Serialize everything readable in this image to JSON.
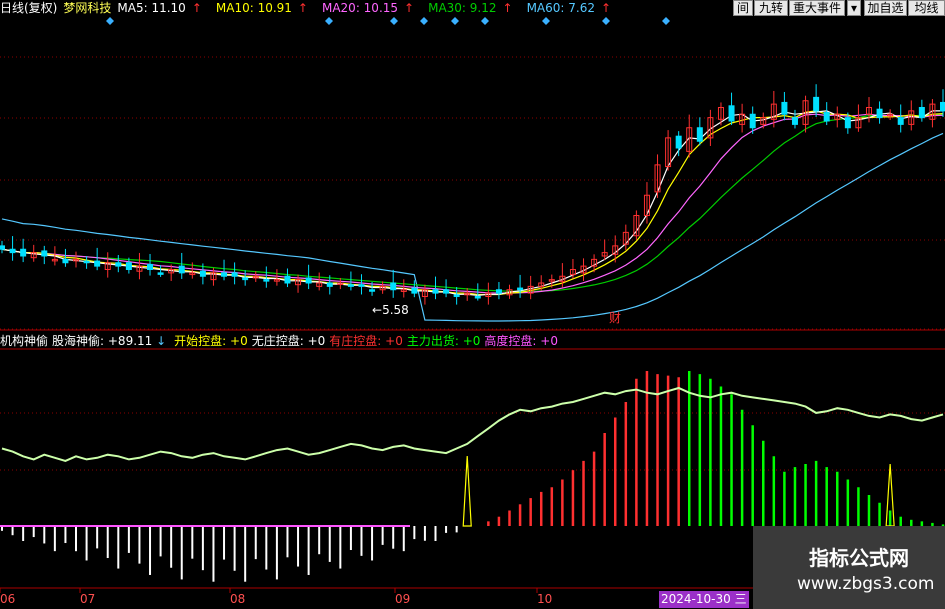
{
  "header": {
    "period": "日线(复权)",
    "stock": "梦网科技",
    "ma": [
      {
        "label": "MA5:",
        "value": "11.10",
        "color": "#ffffff",
        "arrow": "↑"
      },
      {
        "label": "MA10:",
        "value": "10.91",
        "color": "#ffff00",
        "arrow": "↑"
      },
      {
        "label": "MA20:",
        "value": "10.15",
        "color": "#ff66ff",
        "arrow": "↑"
      },
      {
        "label": "MA30:",
        "value": "9.12",
        "color": "#00cc00",
        "arrow": "↑"
      },
      {
        "label": "MA60:",
        "value": "7.62",
        "color": "#55c8ff",
        "arrow": "↑"
      }
    ],
    "buttons": [
      "间",
      "九转",
      "重大事件",
      "▾",
      "加自选",
      "均线"
    ]
  },
  "price_annotations": {
    "low": "5.58",
    "low_arrow": "←",
    "event": "财"
  },
  "indicator_header": {
    "name": "机构神偷",
    "items": [
      {
        "label": "股海神偷:",
        "value": "+89.11",
        "suffix": "↓",
        "color": "#ffffff"
      },
      {
        "label": "开始控盘:",
        "value": "+0",
        "color": "#ffff00"
      },
      {
        "label": "无庄控盘:",
        "value": "+0",
        "color": "#ffffff"
      },
      {
        "label": "有庄控盘:",
        "value": "+0",
        "color": "#ff3030"
      },
      {
        "label": "主力出货:",
        "value": "+0",
        "color": "#00ff00"
      },
      {
        "label": "高度控盘:",
        "value": "+0",
        "color": "#ff55ff"
      }
    ]
  },
  "x_axis": {
    "labels": [
      "06",
      "07",
      "08",
      "09",
      "10"
    ],
    "cursor_date": "2024-10-30",
    "cursor_day": "三"
  },
  "watermark": {
    "title": "指标公式网",
    "url": "www.zbgs3.com"
  },
  "colors": {
    "up": "#ff3030",
    "down": "#00e0ff",
    "ma5": "#ffffff",
    "ma10": "#ffff00",
    "ma20": "#ff66ff",
    "ma30": "#00cc00",
    "ma60": "#55c8ff",
    "line": "#ccffaa",
    "grid": "#8b0000"
  },
  "chart_data": [
    {
      "type": "candlestick",
      "title": "",
      "x_labels": [
        "06",
        "07",
        "08",
        "09",
        "10"
      ],
      "price_low": 5.58,
      "close": [
        7.0,
        6.9,
        6.8,
        6.9,
        6.8,
        6.7,
        6.6,
        6.7,
        6.6,
        6.5,
        6.6,
        6.5,
        6.4,
        6.5,
        6.4,
        6.3,
        6.4,
        6.3,
        6.3,
        6.2,
        6.3,
        6.2,
        6.2,
        6.1,
        6.2,
        6.1,
        6.1,
        6.0,
        6.1,
        6.0,
        6.0,
        5.9,
        6.0,
        5.9,
        5.9,
        5.8,
        5.9,
        5.8,
        5.8,
        5.7,
        5.8,
        5.7,
        5.7,
        5.6,
        5.7,
        5.6,
        5.7,
        5.7,
        5.8,
        5.8,
        5.9,
        6.0,
        6.1,
        6.2,
        6.4,
        6.5,
        6.7,
        6.9,
        7.1,
        7.5,
        8.0,
        8.6,
        9.5,
        10.3,
        10.0,
        10.6,
        10.2,
        10.9,
        11.2,
        10.8,
        11.0,
        10.6,
        10.9,
        11.3,
        11.0,
        10.7,
        11.4,
        11.1,
        10.8,
        11.0,
        10.6,
        10.9,
        11.2,
        10.9,
        11.0,
        10.7,
        11.1,
        10.9,
        11.3,
        11.1
      ],
      "ma": {
        "MA5": 11.1,
        "MA10": 10.91,
        "MA20": 10.15,
        "MA30": 9.12,
        "MA60": 7.62
      }
    },
    {
      "type": "bar",
      "title": "机构神偷",
      "series": [
        {
          "name": "股海神偷",
          "values": [
            50,
            48,
            45,
            43,
            46,
            44,
            42,
            45,
            43,
            44,
            46,
            45,
            43,
            44,
            46,
            48,
            47,
            45,
            44,
            46,
            47,
            45,
            44,
            43,
            45,
            47,
            49,
            50,
            48,
            46,
            47,
            49,
            51,
            53,
            52,
            50,
            49,
            51,
            52,
            50,
            49,
            48,
            47,
            50,
            53,
            58,
            63,
            68,
            72,
            75,
            74,
            76,
            77,
            79,
            80,
            82,
            84,
            86,
            85,
            87,
            88,
            86,
            85,
            87,
            89,
            86,
            84,
            83,
            85,
            86,
            84,
            83,
            82,
            81,
            80,
            79,
            77,
            73,
            74,
            76,
            75,
            73,
            71,
            70,
            72,
            71,
            69,
            68,
            70,
            72
          ]
        },
        {
          "name": "有庄控盘",
          "values": [
            0,
            0,
            0,
            0,
            0,
            0,
            0,
            0,
            0,
            0,
            0,
            0,
            0,
            0,
            0,
            0,
            0,
            0,
            0,
            0,
            0,
            0,
            0,
            0,
            0,
            0,
            0,
            0,
            0,
            0,
            0,
            0,
            0,
            0,
            0,
            0,
            0,
            0,
            0,
            0,
            0,
            0,
            0,
            0,
            0,
            0,
            3,
            6,
            10,
            14,
            18,
            22,
            25,
            30,
            36,
            42,
            48,
            60,
            70,
            80,
            95,
            100,
            98,
            97,
            96,
            0,
            0,
            0,
            0,
            0,
            0,
            0,
            0,
            0,
            0,
            0,
            0,
            0,
            0,
            0,
            0,
            0,
            0,
            0,
            0,
            0,
            0,
            0,
            0,
            0
          ]
        },
        {
          "name": "主力出货",
          "values": [
            0,
            0,
            0,
            0,
            0,
            0,
            0,
            0,
            0,
            0,
            0,
            0,
            0,
            0,
            0,
            0,
            0,
            0,
            0,
            0,
            0,
            0,
            0,
            0,
            0,
            0,
            0,
            0,
            0,
            0,
            0,
            0,
            0,
            0,
            0,
            0,
            0,
            0,
            0,
            0,
            0,
            0,
            0,
            0,
            0,
            0,
            0,
            0,
            0,
            0,
            0,
            0,
            0,
            0,
            0,
            0,
            0,
            0,
            0,
            0,
            0,
            0,
            0,
            0,
            0,
            100,
            98,
            95,
            90,
            85,
            75,
            65,
            55,
            45,
            35,
            38,
            40,
            42,
            38,
            35,
            30,
            25,
            20,
            15,
            10,
            6,
            4,
            3,
            2,
            1
          ]
        }
      ]
    }
  ]
}
